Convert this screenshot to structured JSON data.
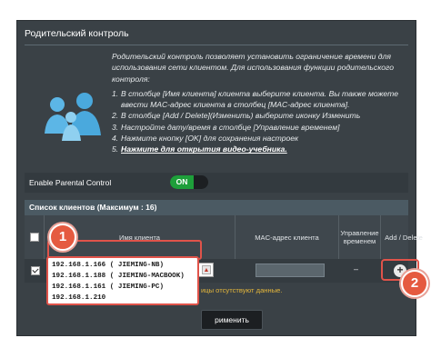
{
  "panel": {
    "title": "Родительский контроль",
    "description": "Родительский контроль позволяет установить ограничение времени для использования сети клиентом. Для использования функции родительского контроля:",
    "steps": [
      {
        "num": "1.",
        "text": "В столбце [Имя клиента] клиента выберите клиента. Вы также можете ввести MAC-адрес клиента в столбец [MAC-адрес клиента]."
      },
      {
        "num": "2.",
        "text": "В столбце [Add / Delete](Изменить) выберите иконку Изменить"
      },
      {
        "num": "3.",
        "text": "Настройте дату/время в столбце [Управление временем]"
      },
      {
        "num": "4.",
        "text": "Нажмите кнопку [OK] для сохранения настроек"
      },
      {
        "num": "5.",
        "text": "Нажмите для открытия видео-учебника."
      }
    ]
  },
  "enable": {
    "label": "Enable Parental Control",
    "toggle_state": "ON"
  },
  "client_table": {
    "title": "Список клиентов (Максимум : 16)",
    "columns": [
      "Имя клиента",
      "MAC-адрес клиента",
      "Управление временем",
      "Add / Delete"
    ],
    "row": {
      "time_value": "–"
    },
    "no_data_text": "ицы отсутствуют данные."
  },
  "dropdown": {
    "options": [
      "192.168.1.166 ( JIEMING-NB)",
      "192.168.1.188 ( JIEMING-MACBOOK)",
      "192.168.1.161 ( JIEMING-PC)",
      "192.168.1.210"
    ]
  },
  "apply_label": "рименить",
  "badges": [
    "1",
    "2"
  ],
  "icons": {
    "family": "family-icon",
    "add": "plus-circle-icon",
    "dropdown": "triangle-up-icon"
  },
  "colors": {
    "accent_red": "#e0534a",
    "toggle_on": "#1e9f3a",
    "panel": "#3a4146"
  }
}
